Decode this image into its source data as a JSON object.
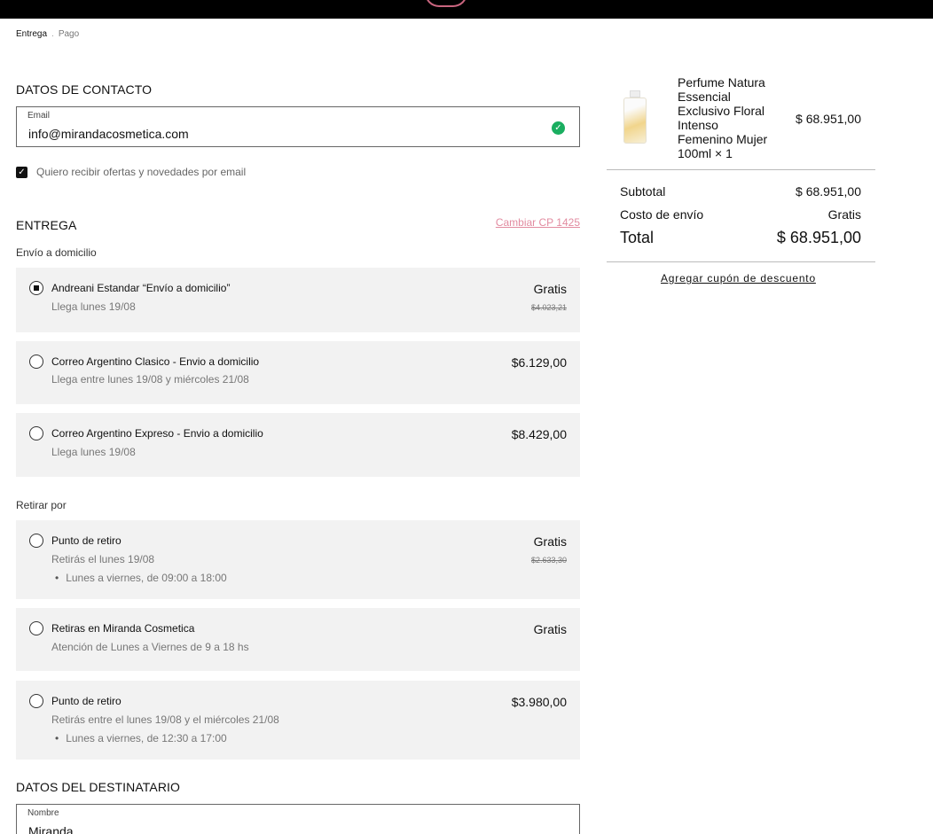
{
  "breadcrumb": {
    "step1": "Entrega",
    "separator": ".",
    "step2": "Pago"
  },
  "contact": {
    "heading": "DATOS DE CONTACTO",
    "email_label": "Email",
    "email_value": "info@mirandacosmetica.com",
    "optin_label": "Quiero recibir ofertas y novedades por email",
    "optin_checked": true
  },
  "delivery": {
    "heading": "ENTREGA",
    "change_cp_link": "Cambiar CP 1425",
    "home_subtitle": "Envío a domicilio",
    "home_options": [
      {
        "title": "Andreani Estandar “Envío a domicilio”",
        "detail": "Llega lunes 19/08",
        "price": "Gratis",
        "strike": "$4.023,21",
        "selected": true
      },
      {
        "title": "Correo Argentino Clasico - Envio a domicilio",
        "detail": "Llega entre lunes 19/08 y miércoles 21/08",
        "price": "$6.129,00",
        "selected": false
      },
      {
        "title": "Correo Argentino Expreso - Envio a domicilio",
        "detail": "Llega lunes 19/08",
        "price": "$8.429,00",
        "selected": false
      }
    ],
    "pickup_subtitle": "Retirar por",
    "pickup_options": [
      {
        "title": "Punto de retiro",
        "detail": "Retirás el lunes 19/08",
        "bullet": "Lunes a viernes, de 09:00 a 18:00",
        "price": "Gratis",
        "strike": "$2.633,30",
        "selected": false
      },
      {
        "title": "Retiras en Miranda Cosmetica",
        "detail": "Atención de Lunes a Viernes de 9 a 18 hs",
        "price": "Gratis",
        "selected": false
      },
      {
        "title": "Punto de retiro",
        "detail": "Retirás entre el lunes 19/08 y el miércoles 21/08",
        "bullet": "Lunes a viernes, de 12:30 a 17:00",
        "price": "$3.980,00",
        "selected": false
      }
    ]
  },
  "recipient": {
    "heading": "DATOS DEL DESTINATARIO",
    "name_label": "Nombre",
    "name_value": "Miranda"
  },
  "order": {
    "product_name": "Perfume Natura Essencial Exclusivo Floral Intenso Femenino Mujer 100ml × 1",
    "product_price": "$ 68.951,00",
    "subtotal_label": "Subtotal",
    "subtotal_value": "$ 68.951,00",
    "shipping_label": "Costo de envío",
    "shipping_value": "Gratis",
    "total_label": "Total",
    "total_value": "$ 68.951,00",
    "coupon_link": "Agregar cupón de descuento"
  }
}
